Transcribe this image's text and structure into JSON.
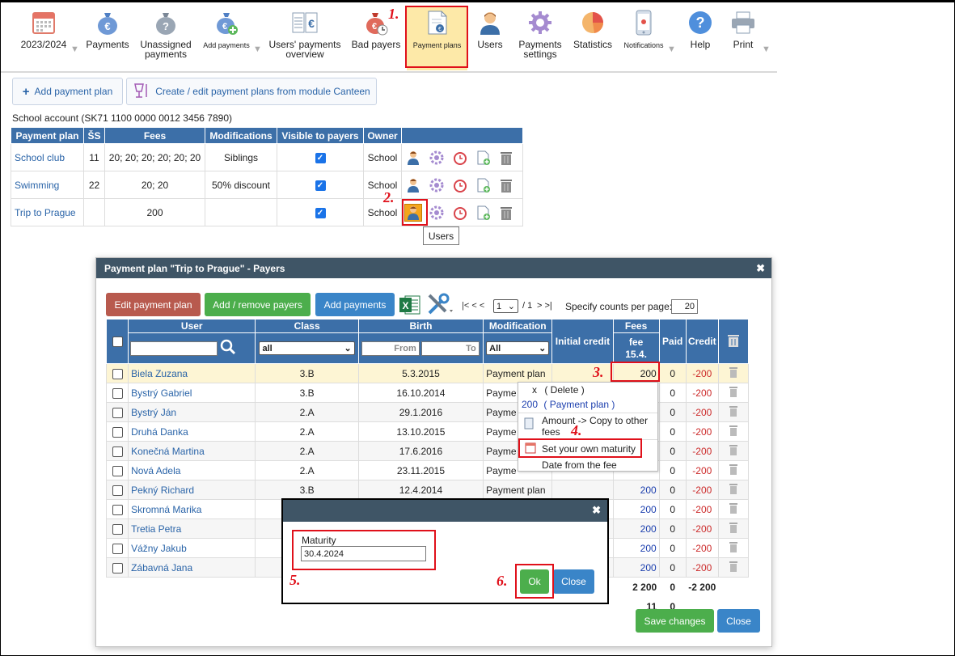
{
  "toolbar": {
    "year": "2023/2024",
    "payments": "Payments",
    "unassigned_1": "Unassigned",
    "unassigned_2": "payments",
    "add_payments": "Add payments",
    "users_overview_1": "Users' payments",
    "users_overview_2": "overview",
    "bad_payers": "Bad payers",
    "payment_plans": "Payment plans",
    "users": "Users",
    "settings_1": "Payments",
    "settings_2": "settings",
    "statistics": "Statistics",
    "notifications": "Notifications",
    "help": "Help",
    "print": "Print"
  },
  "annotations": {
    "a1": "1.",
    "a2": "2.",
    "a3": "3.",
    "a4": "4.",
    "a5": "5.",
    "a6": "6."
  },
  "actions": {
    "add_plan": "Add payment plan",
    "canteen": "Create / edit payment plans from module Canteen"
  },
  "account": "School account (SK71 1100 0000 0012 3456 7890)",
  "plans_table": {
    "headers": [
      "Payment plan",
      "ŠS",
      "Fees",
      "Modifications",
      "Visible to payers",
      "Owner"
    ],
    "rows": [
      {
        "plan": "School club",
        "ss": "11",
        "fees": "20; 20; 20; 20; 20; 20",
        "mods": "Siblings",
        "owner": "School"
      },
      {
        "plan": "Swimming",
        "ss": "22",
        "fees": "20; 20",
        "mods": "50% discount",
        "owner": "School"
      },
      {
        "plan": "Trip to Prague",
        "ss": "",
        "fees": "200",
        "mods": "",
        "owner": "School"
      }
    ]
  },
  "tooltip": "Users",
  "dialog": {
    "title": "Payment plan \"Trip to Prague\" - Payers",
    "edit_btn": "Edit payment plan",
    "addremove_btn": "Add / remove payers",
    "addpay_btn": "Add payments",
    "pager_nav_left": "|< < <",
    "page_value": "1",
    "page_total": "/ 1",
    "pager_nav_right": "> >|",
    "counts_label": "Specify counts per page:",
    "counts_value": "20",
    "headers": {
      "user": "User",
      "class": "Class",
      "birth": "Birth",
      "modification": "Modification",
      "initial_credit": "Initial credit",
      "fees": "Fees",
      "fee_line1": "fee",
      "fee_line2": "15.4.",
      "paid": "Paid",
      "credit": "Credit"
    },
    "filters": {
      "class_value": "all",
      "birth_from": "From",
      "birth_to": "To",
      "mod_value": "All"
    },
    "rows": [
      {
        "user": "Biela Zuzana",
        "class": "3.B",
        "birth": "5.3.2015",
        "mod": "Payment plan",
        "fee": "200",
        "paid": "0",
        "credit": "-200"
      },
      {
        "user": "Bystrý Gabriel",
        "class": "3.B",
        "birth": "16.10.2014",
        "mod": "Payme",
        "fee": "",
        "paid": "0",
        "credit": "-200"
      },
      {
        "user": "Bystrý Ján",
        "class": "2.A",
        "birth": "29.1.2016",
        "mod": "Payme",
        "fee": "",
        "paid": "0",
        "credit": "-200"
      },
      {
        "user": "Druhá Danka",
        "class": "2.A",
        "birth": "13.10.2015",
        "mod": "Payme",
        "fee": "",
        "paid": "0",
        "credit": "-200"
      },
      {
        "user": "Konečná Martina",
        "class": "2.A",
        "birth": "17.6.2016",
        "mod": "Payme",
        "fee": "",
        "paid": "0",
        "credit": "-200"
      },
      {
        "user": "Nová Adela",
        "class": "2.A",
        "birth": "23.11.2015",
        "mod": "Payme",
        "fee": "",
        "paid": "0",
        "credit": "-200"
      },
      {
        "user": "Pekný Richard",
        "class": "3.B",
        "birth": "12.4.2014",
        "mod": "Payment plan",
        "fee": "200",
        "paid": "0",
        "credit": "-200"
      },
      {
        "user": "Skromná Marika",
        "class": "",
        "birth": "",
        "mod": "",
        "fee": "200",
        "paid": "0",
        "credit": "-200"
      },
      {
        "user": "Tretia Petra",
        "class": "",
        "birth": "",
        "mod": "",
        "fee": "200",
        "paid": "0",
        "credit": "-200"
      },
      {
        "user": "Vážny Jakub",
        "class": "",
        "birth": "",
        "mod": "",
        "fee": "200",
        "paid": "0",
        "credit": "-200"
      },
      {
        "user": "Zábavná Jana",
        "class": "",
        "birth": "",
        "mod": "",
        "fee": "200",
        "paid": "0",
        "credit": "-200"
      }
    ],
    "totals": {
      "fee": "2 200",
      "paid": "0",
      "credit": "-2 200",
      "count_fee": "11",
      "count_paid": "0"
    },
    "save_btn": "Save changes",
    "close_btn": "Close"
  },
  "context_menu": {
    "delete_x": "x",
    "delete_label": "( Delete )",
    "plan_value": "200",
    "plan_label": "( Payment plan )",
    "copy_1": "Amount -> Copy to other",
    "copy_2": "fees",
    "maturity": "Set your own maturity",
    "date_from_fee": "Date from the fee"
  },
  "maturity_modal": {
    "label": "Maturity",
    "value": "30.4.2024",
    "ok": "Ok",
    "close": "Close"
  }
}
